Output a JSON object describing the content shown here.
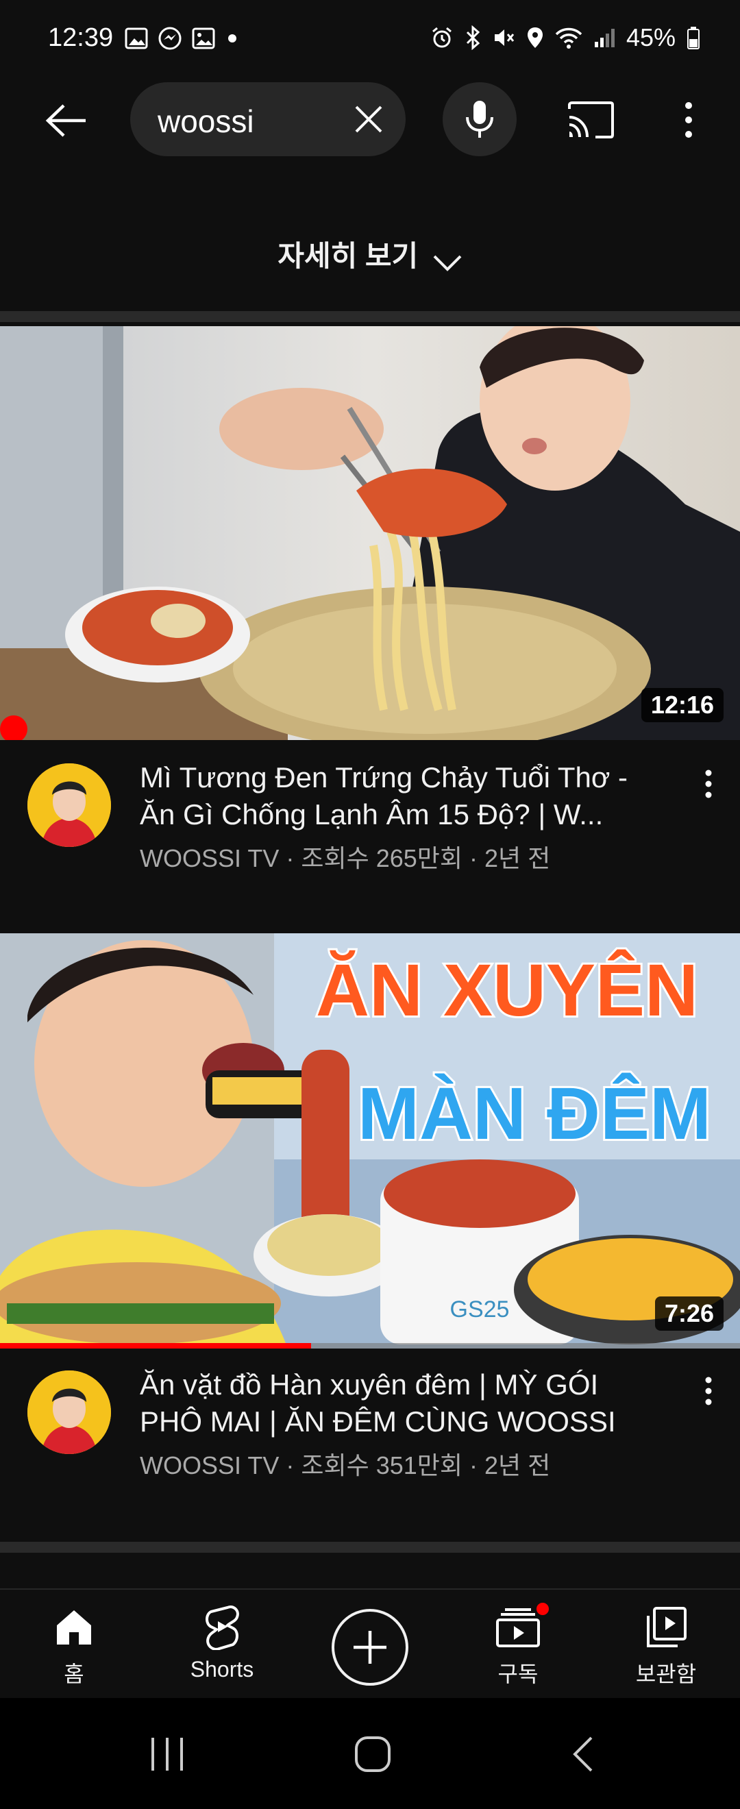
{
  "status_bar": {
    "time": "12:39",
    "battery": "45%",
    "left_icons": [
      "image-icon",
      "messenger-icon",
      "gallery-icon",
      "dot-icon"
    ],
    "right_icons": [
      "alarm-icon",
      "bluetooth-icon",
      "mute-icon",
      "location-icon",
      "wifi-icon",
      "signal-icon",
      "battery-icon"
    ]
  },
  "header": {
    "search_query": "woossi"
  },
  "more_details": {
    "label": "자세히 보기"
  },
  "videos": [
    {
      "title": "Mì Tương Đen Trứng Chảy Tuổi Thơ - Ăn Gì Chống Lạnh Âm 15 Độ? | W...",
      "channel_info": "WOOSSI TV · 조회수 265만회 · 2년 전",
      "duration": "12:16",
      "progress": 0.0
    },
    {
      "title": "Ăn vặt đồ Hàn xuyên đêm | MỲ GÓI PHÔ MAI | ĂN ĐÊM CÙNG WOOSSI",
      "channel_info": "WOOSSI TV · 조회수 351만회 · 2년 전",
      "duration": "7:26",
      "thumbnail_text_1": "ĂN XUYÊN",
      "thumbnail_text_2": "MÀN ĐÊM",
      "store_sign": "GS25",
      "progress": 0.42
    }
  ],
  "bottom_nav": {
    "home": "홈",
    "shorts": "Shorts",
    "subscriptions": "구독",
    "library": "보관함"
  },
  "colors": {
    "background": "#0f0f0f",
    "accent_red": "#ff0000",
    "secondary_text": "#aaaaaa",
    "search_bg": "#272727"
  }
}
